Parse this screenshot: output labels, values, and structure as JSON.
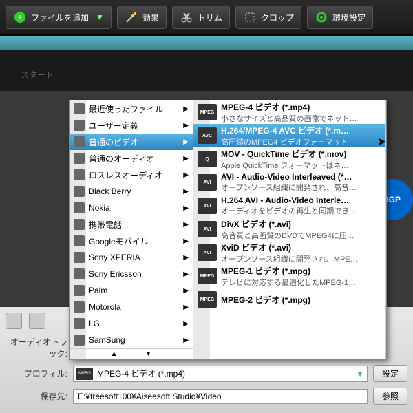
{
  "toolbar": {
    "add_file": "ファイルを追加",
    "effect": "効果",
    "trim": "トリム",
    "crop": "クロップ",
    "settings": "環境設定"
  },
  "dark_title": "スタート",
  "categories": [
    {
      "label": "最近使ったファイル",
      "selected": false
    },
    {
      "label": "ユーザー定義",
      "selected": false
    },
    {
      "label": "普通のビデオ",
      "selected": true
    },
    {
      "label": "普通のオーディオ",
      "selected": false
    },
    {
      "label": "ロスレスオーディオ",
      "selected": false
    },
    {
      "label": "Black Berry",
      "selected": false
    },
    {
      "label": "Nokia",
      "selected": false
    },
    {
      "label": "携帯電話",
      "selected": false
    },
    {
      "label": "Googleモバイル",
      "selected": false
    },
    {
      "label": "Sony XPERIA",
      "selected": false
    },
    {
      "label": "Sony Ericsson",
      "selected": false
    },
    {
      "label": "Palm",
      "selected": false
    },
    {
      "label": "Motorola",
      "selected": false
    },
    {
      "label": "LG",
      "selected": false
    },
    {
      "label": "SamSung",
      "selected": false
    }
  ],
  "formats": [
    {
      "icon": "MPEG",
      "title": "MPEG-4 ビデオ (*.mp4)",
      "desc": "小さなサイズと高品質の画像でネット…",
      "selected": false
    },
    {
      "icon": "AVC",
      "title": "H.264/MPEG-4 AVC ビデオ (*.m…",
      "desc": "高圧縮のMPEG4 ビデオフォーマット",
      "selected": true
    },
    {
      "icon": "Q",
      "title": "MOV - QuickTime ビデオ (*.mov)",
      "desc": "Apple QuickTime フォーマットはネ…",
      "selected": false
    },
    {
      "icon": "AVI",
      "title": "AVI - Audio-Video Interleaved (*…",
      "desc": "オープンソース組織に開発され、高音…",
      "selected": false
    },
    {
      "icon": "AVI",
      "title": "H.264 AVI - Audio-Video Interle…",
      "desc": "オーディオをビデオの再生と同期でき…",
      "selected": false
    },
    {
      "icon": "AVI",
      "title": "DivX ビデオ (*.avi)",
      "desc": "高音質と高画質のDVDでMPEG4に圧…",
      "selected": false
    },
    {
      "icon": "AVI",
      "title": "XviD ビデオ (*.avi)",
      "desc": "オープンソース組織に開発され、MPE…",
      "selected": false
    },
    {
      "icon": "MPEG",
      "title": "MPEG-1 ビデオ (*.mpg)",
      "desc": "テレビに対応する最適化したMPEG-1…",
      "selected": false
    },
    {
      "icon": "MPEG",
      "title": "MPEG-2 ビデオ (*.mpg)",
      "desc": "",
      "selected": false
    }
  ],
  "side_badge": "3GP",
  "bottom": {
    "audio_track_label": "オーディオトラック:",
    "search_placeholder": "",
    "profile_label": "プロフィル:",
    "profile_value": "MPEG-4 ビデオ (*.mp4)",
    "profile_icon": "MPEG",
    "settings_btn": "設定",
    "save_label": "保存先:",
    "save_path": "E:¥freesoft100¥Aiseesoft Studio¥Video",
    "browse_btn": "参照"
  }
}
